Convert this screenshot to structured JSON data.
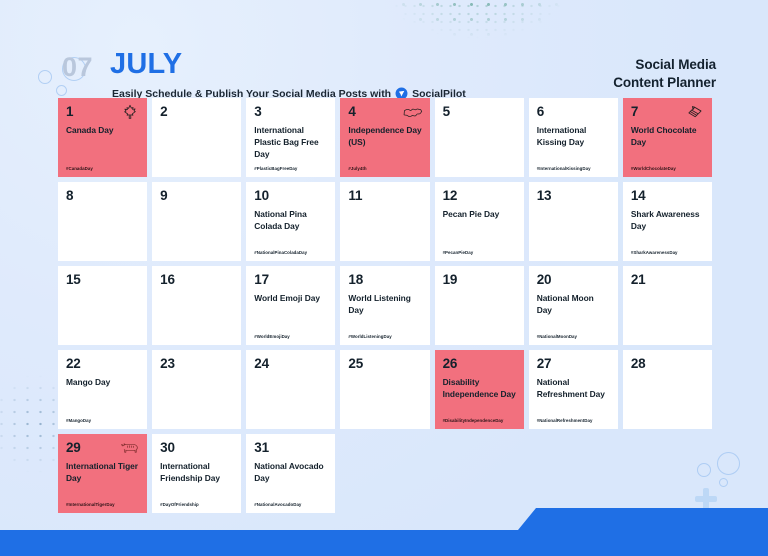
{
  "header": {
    "month_number": "07",
    "month_name": "JULY",
    "tagline": "Easily Schedule & Publish Your Social Media Posts with",
    "brand": "SocialPilot",
    "title_line1": "Social Media",
    "title_line2": "Content Planner"
  },
  "colors": {
    "accent_blue": "#1f6fe5",
    "highlight_red": "#f2707e",
    "card_white": "#ffffff",
    "background": "#dce9fb",
    "text_dark": "#14212c",
    "month_number_gray": "#b9c7dc"
  },
  "calendar": {
    "days": [
      {
        "number": "1",
        "event": "Canada Day",
        "hashtag": "#CanadaDay",
        "highlight": true,
        "icon": "maple-leaf-icon"
      },
      {
        "number": "2",
        "event": "",
        "hashtag": "",
        "highlight": false,
        "icon": ""
      },
      {
        "number": "3",
        "event": "International Plastic Bag Free Day",
        "hashtag": "#PlasticBagFreeDay",
        "highlight": false,
        "icon": ""
      },
      {
        "number": "4",
        "event": "Independence Day (US)",
        "hashtag": "#July4th",
        "highlight": true,
        "icon": "usa-map-icon"
      },
      {
        "number": "5",
        "event": "",
        "hashtag": "",
        "highlight": false,
        "icon": ""
      },
      {
        "number": "6",
        "event": "International Kissing Day",
        "hashtag": "#InternationalKissingDay",
        "highlight": false,
        "icon": ""
      },
      {
        "number": "7",
        "event": "World Chocolate Day",
        "hashtag": "#WorldChocolateDay",
        "highlight": true,
        "icon": "chocolate-bar-icon"
      },
      {
        "number": "8",
        "event": "",
        "hashtag": "",
        "highlight": false,
        "icon": ""
      },
      {
        "number": "9",
        "event": "",
        "hashtag": "",
        "highlight": false,
        "icon": ""
      },
      {
        "number": "10",
        "event": "National Pina Colada Day",
        "hashtag": "#NationalPinaColadaDay",
        "highlight": false,
        "icon": ""
      },
      {
        "number": "11",
        "event": "",
        "hashtag": "",
        "highlight": false,
        "icon": ""
      },
      {
        "number": "12",
        "event": "Pecan Pie Day",
        "hashtag": "#PecanPieDay",
        "highlight": false,
        "icon": ""
      },
      {
        "number": "13",
        "event": "",
        "hashtag": "",
        "highlight": false,
        "icon": ""
      },
      {
        "number": "14",
        "event": "Shark Awareness Day",
        "hashtag": "#SharkAwarenessDay",
        "highlight": false,
        "icon": ""
      },
      {
        "number": "15",
        "event": "",
        "hashtag": "",
        "highlight": false,
        "icon": ""
      },
      {
        "number": "16",
        "event": "",
        "hashtag": "",
        "highlight": false,
        "icon": ""
      },
      {
        "number": "17",
        "event": "World Emoji Day",
        "hashtag": "#WorldEmojiDay",
        "highlight": false,
        "icon": ""
      },
      {
        "number": "18",
        "event": "World Listening Day",
        "hashtag": "#WorldListeningDay",
        "highlight": false,
        "icon": ""
      },
      {
        "number": "19",
        "event": "",
        "hashtag": "",
        "highlight": false,
        "icon": ""
      },
      {
        "number": "20",
        "event": "National Moon Day",
        "hashtag": "#NationalMoonDay",
        "highlight": false,
        "icon": ""
      },
      {
        "number": "21",
        "event": "",
        "hashtag": "",
        "highlight": false,
        "icon": ""
      },
      {
        "number": "22",
        "event": "Mango Day",
        "hashtag": "#MangoDay",
        "highlight": false,
        "icon": ""
      },
      {
        "number": "23",
        "event": "",
        "hashtag": "",
        "highlight": false,
        "icon": ""
      },
      {
        "number": "24",
        "event": "",
        "hashtag": "",
        "highlight": false,
        "icon": ""
      },
      {
        "number": "25",
        "event": "",
        "hashtag": "",
        "highlight": false,
        "icon": ""
      },
      {
        "number": "26",
        "event": "Disability Independence Day",
        "hashtag": "#DisabilityIndependenceDay",
        "highlight": true,
        "icon": ""
      },
      {
        "number": "27",
        "event": "National Refreshment Day",
        "hashtag": "#NationalRefreshmentDay",
        "highlight": false,
        "icon": ""
      },
      {
        "number": "28",
        "event": "",
        "hashtag": "",
        "highlight": false,
        "icon": ""
      },
      {
        "number": "29",
        "event": "International Tiger Day",
        "hashtag": "#InternationalTigerDay",
        "highlight": true,
        "icon": "tiger-icon"
      },
      {
        "number": "30",
        "event": "International Friendship Day",
        "hashtag": "#DayOfFriendship",
        "highlight": false,
        "icon": ""
      },
      {
        "number": "31",
        "event": "National Avocado Day",
        "hashtag": "#NationalAvocadoDay",
        "highlight": false,
        "icon": ""
      }
    ]
  }
}
